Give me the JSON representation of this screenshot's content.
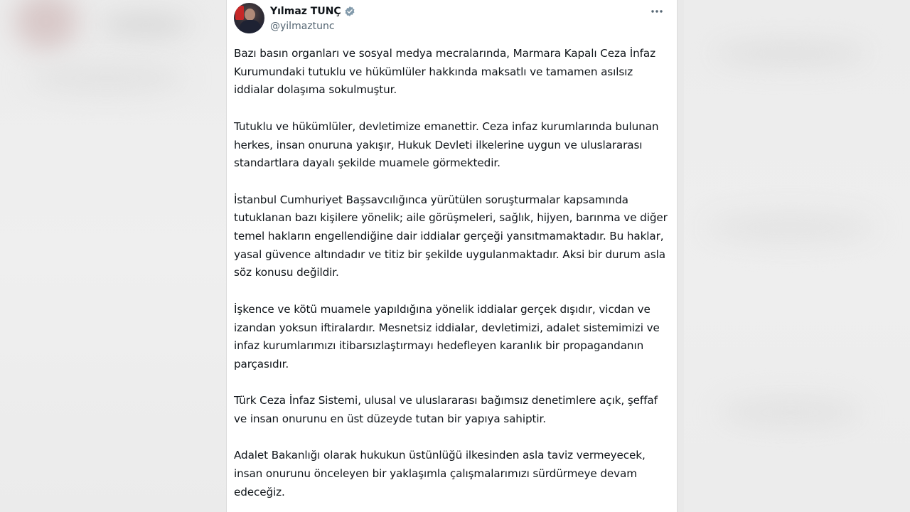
{
  "tweet": {
    "author": {
      "display_name": "Yılmaz TUNÇ",
      "handle": "@yilmaztunc",
      "verified": true,
      "verified_badge_color": "#829aab"
    },
    "more_icon": "more-horizontal-icon",
    "paragraphs": [
      "Bazı basın organları ve sosyal medya mecralarında, Marmara Kapalı Ceza İnfaz Kurumundaki tutuklu ve hükümlüler hakkında maksatlı ve tamamen asılsız iddialar dolaşıma sokulmuştur.",
      "Tutuklu ve hükümlüler, devletimize emanettir. Ceza infaz kurumlarında bulunan herkes, insan onuruna yakışır, Hukuk Devleti ilkelerine uygun ve uluslararası standartlara dayalı şekilde muamele görmektedir.",
      "İstanbul Cumhuriyet Başsavcılığınca yürütülen soruşturmalar kapsamında tutuklanan bazı kişilere yönelik; aile görüşmeleri, sağlık, hijyen, barınma ve diğer temel hakların engellendiğine dair iddialar gerçeği yansıtmamaktadır. Bu haklar, yasal güvence altındadır ve titiz bir şekilde uygulanmaktadır. Aksi bir durum asla söz konusu değildir.",
      "İşkence ve kötü muamele yapıldığına yönelik iddialar gerçek dışıdır, vicdan ve izandan yoksun iftiralardır. Mesnetsiz iddialar, devletimizi, adalet sistemimizi ve infaz kurumlarımızı itibarsızlaştırmayı hedefleyen karanlık bir propagandanın parçasıdır.",
      "Türk Ceza İnfaz Sistemi, ulusal ve uluslararası bağımsız denetimlere açık, şeffaf ve insan onurunu en üst düzeyde tutan bir yapıya sahiptir.",
      "Adalet Bakanlığı olarak hukukun üstünlüğü ilkesinden asla taviz vermeyecek, insan onurunu önceleyen bir yaklaşımla çalışmalarımızı sürdürmeye devam edeceğiz."
    ]
  }
}
